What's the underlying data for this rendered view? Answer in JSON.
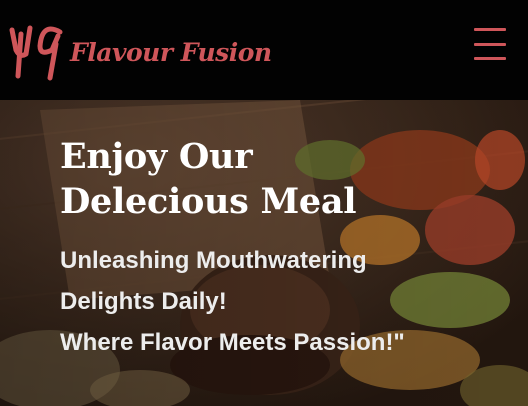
{
  "header": {
    "brand_name": "Flavour Fusion",
    "logo_icon": "fork-knife-logo-icon",
    "menu_icon": "hamburger-menu-icon",
    "brand_color": "#cf565a",
    "background_color": "#020202"
  },
  "hero": {
    "title_line1": "Enjoy Our",
    "title_line2": "Delecious Meal",
    "subtitle_line1": "Unleashing Mouthwatering",
    "subtitle_line2": "Delights Daily!",
    "subtitle_line3": "Where Flavor Meets Passion!\"",
    "background_image": "food-platter-photo"
  }
}
